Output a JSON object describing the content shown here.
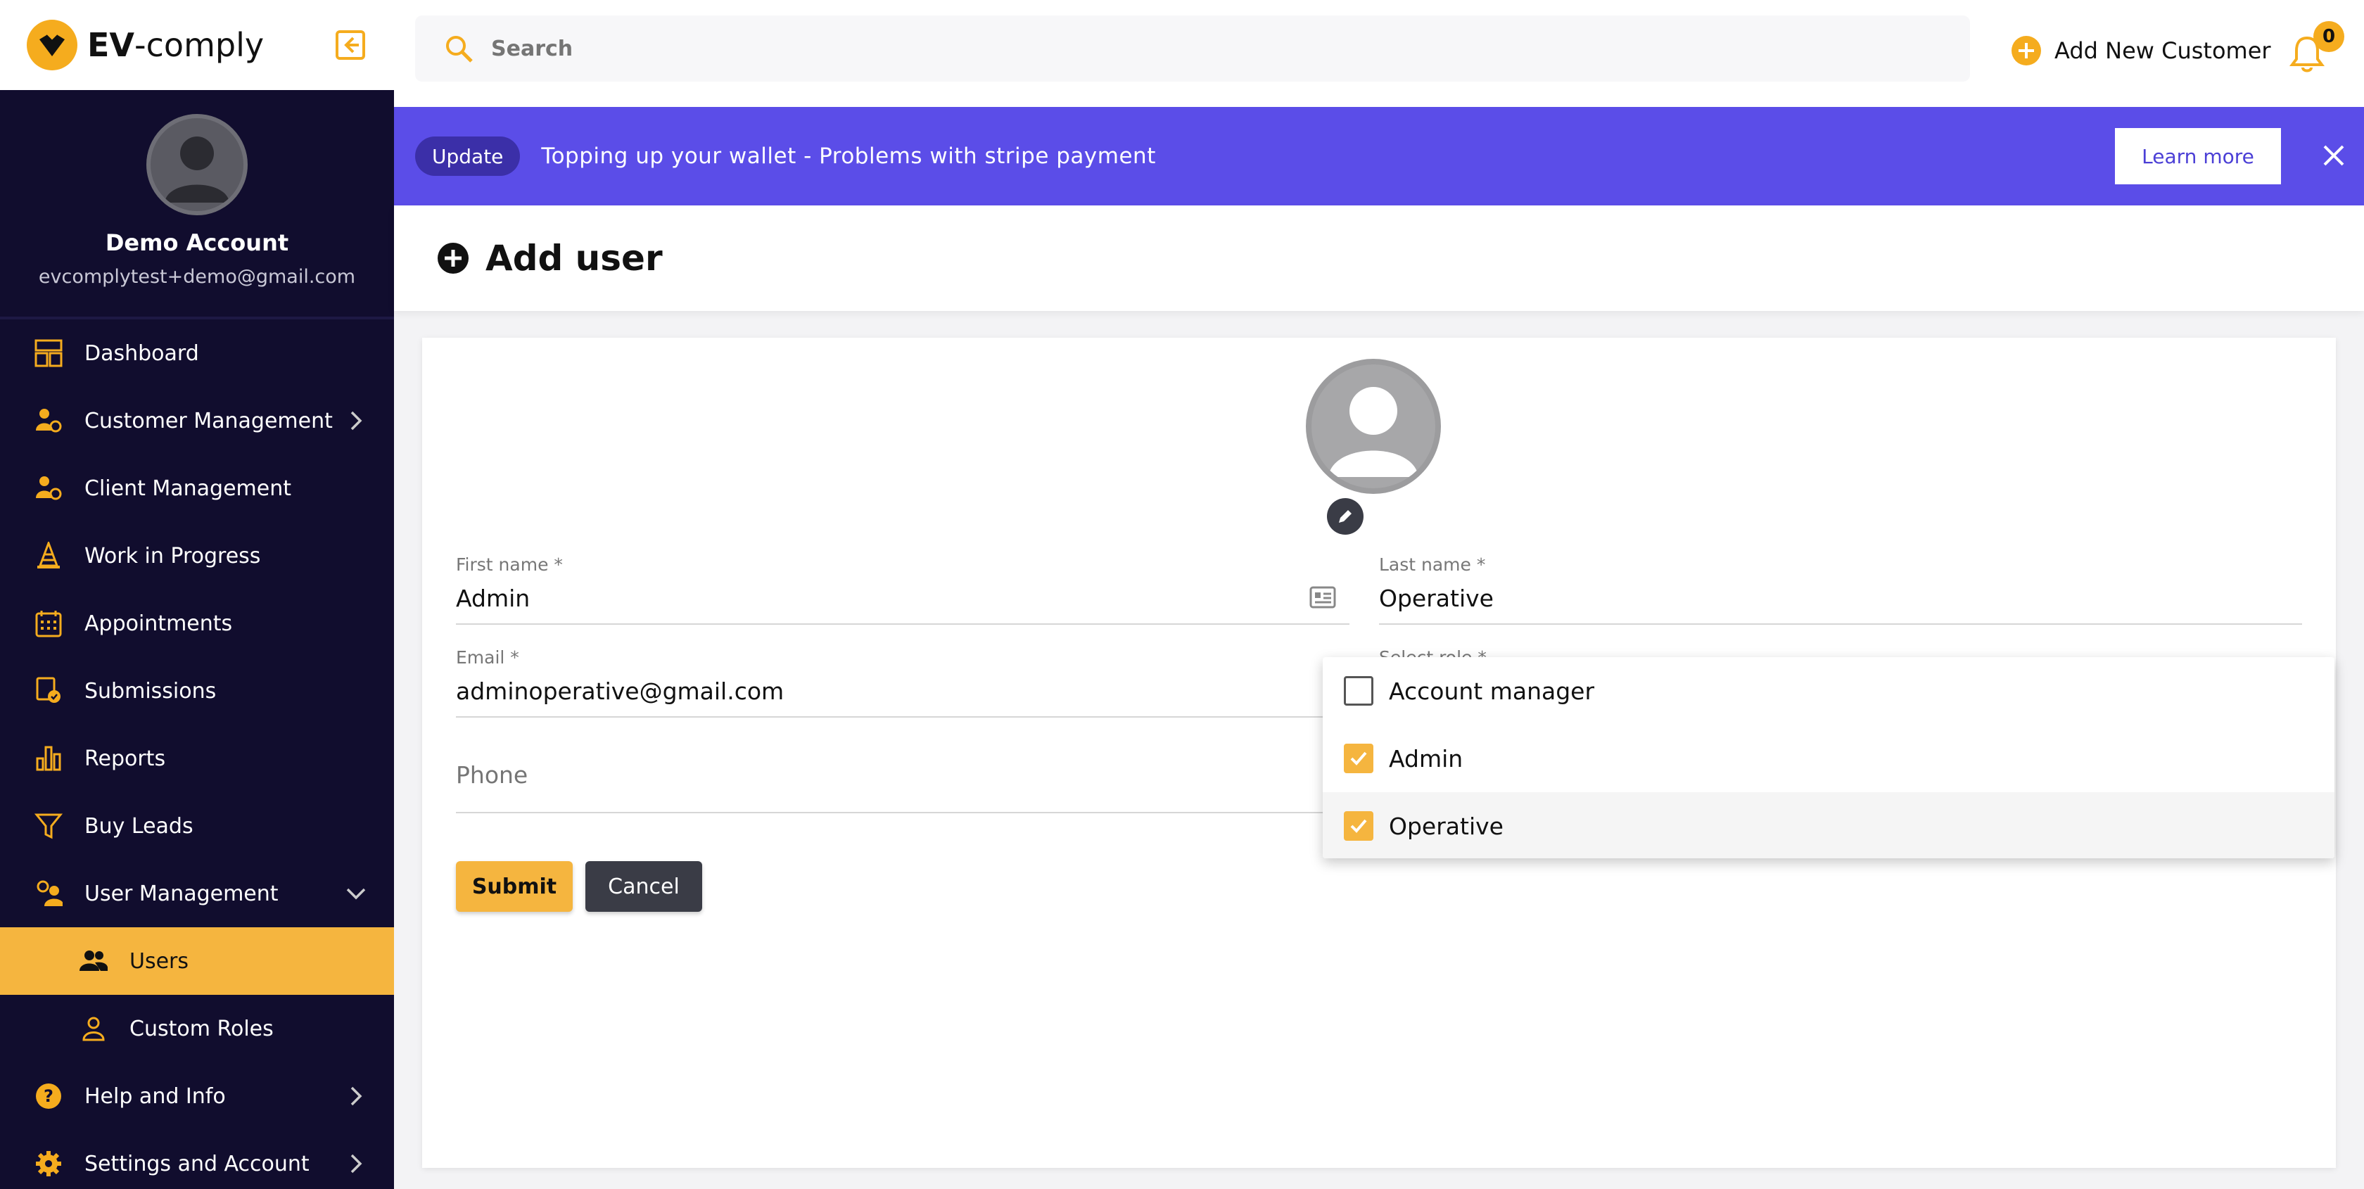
{
  "app": {
    "logo_bold": "EV",
    "logo_rest": "-comply"
  },
  "profile": {
    "name": "Demo Account",
    "email": "evcomplytest+demo@gmail.com"
  },
  "sidebar": {
    "items": [
      {
        "label": "Dashboard",
        "icon": "dashboard-icon"
      },
      {
        "label": "Customer Management",
        "icon": "customer-management-icon"
      },
      {
        "label": "Client Management",
        "icon": "client-management-icon"
      },
      {
        "label": "Work in Progress",
        "icon": "traffic-cone-icon"
      },
      {
        "label": "Appointments",
        "icon": "calendar-icon"
      },
      {
        "label": "Submissions",
        "icon": "submissions-icon"
      },
      {
        "label": "Reports",
        "icon": "bar-chart-icon"
      },
      {
        "label": "Buy Leads",
        "icon": "funnel-icon"
      },
      {
        "label": "User Management",
        "icon": "user-management-icon"
      },
      {
        "label": "Users",
        "icon": "users-icon"
      },
      {
        "label": "Custom Roles",
        "icon": "person-icon"
      },
      {
        "label": "Help and Info",
        "icon": "help-icon"
      },
      {
        "label": "Settings and Account",
        "icon": "gear-icon"
      }
    ],
    "active": "Users"
  },
  "topbar": {
    "search_placeholder": "Search",
    "add_customer": "Add New Customer",
    "notifications": "0"
  },
  "banner": {
    "tag": "Update",
    "message": "Topping up your wallet - Problems with stripe payment",
    "learn_more": "Learn more"
  },
  "page": {
    "title": "Add user"
  },
  "form": {
    "first_name_label": "First name *",
    "first_name_value": "Admin",
    "last_name_label": "Last name *",
    "last_name_value": "Operative",
    "email_label": "Email *",
    "email_value": "adminoperative@gmail.com",
    "role_label": "Select role *",
    "phone_placeholder": "Phone",
    "submit": "Submit",
    "cancel": "Cancel"
  },
  "role_options": [
    {
      "label": "Account manager",
      "checked": false
    },
    {
      "label": "Admin",
      "checked": true
    },
    {
      "label": "Operative",
      "checked": true
    }
  ],
  "colors": {
    "sidebar_bg": "#110d2e",
    "accent": "#f5b53f",
    "banner": "#5b4de8"
  }
}
